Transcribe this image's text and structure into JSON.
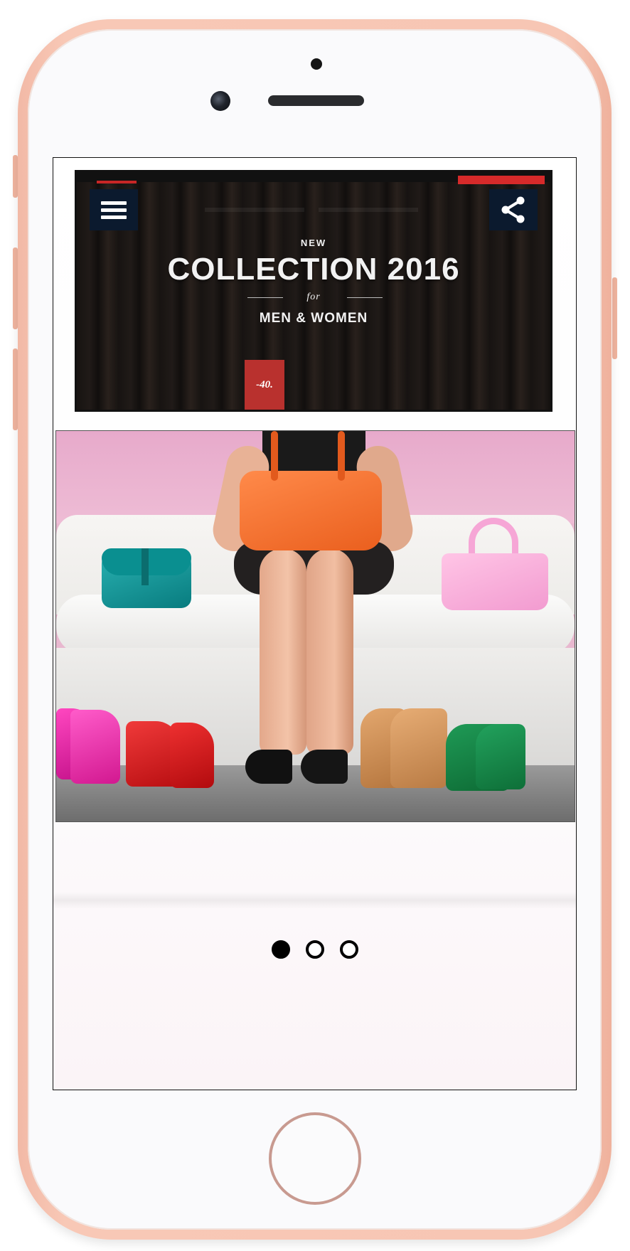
{
  "banner": {
    "new_label": "NEW",
    "title": "COLLECTION 2016",
    "for_label": "for",
    "subtitle": "MEN & WOMEN",
    "price_tag": "-40."
  },
  "icons": {
    "menu": "hamburger-menu-icon",
    "share": "share-icon"
  },
  "carousel": {
    "total": 3,
    "active_index": 0
  },
  "colors": {
    "phone_frame": "#f7c6b4",
    "icon_button_bg": "#0b1a2e",
    "banner_accent": "#d62a2a"
  }
}
